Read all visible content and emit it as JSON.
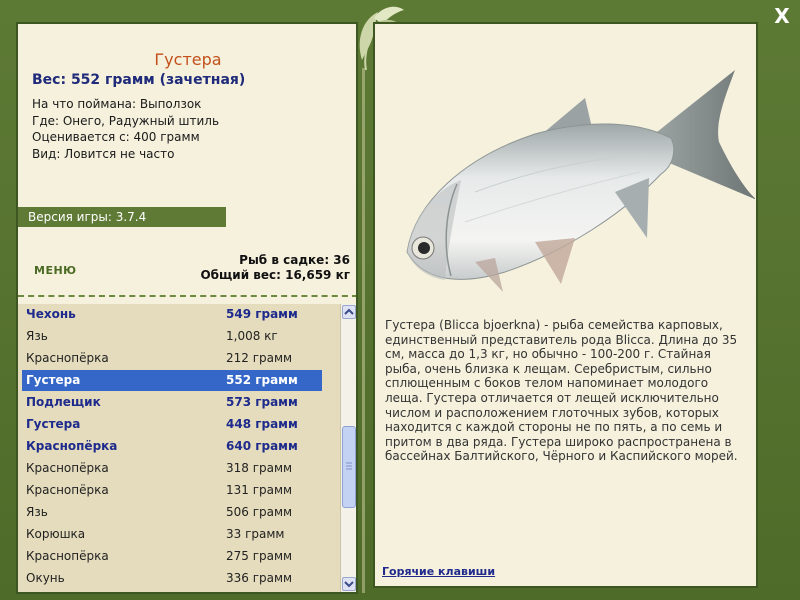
{
  "window": {
    "close_glyph": "X"
  },
  "fish": {
    "name": "Густера",
    "weight_line": "Вес: 552 грамм (зачетная)",
    "caught_on": "На что поймана: Выползок",
    "location": "Где: Онего, Радужный штиль",
    "valued_from": "Оценивается с: 400 грамм",
    "frequency": "Вид: Ловится не часто",
    "description": "Густера (Blicca bjoerkna) - рыба семейства карповых, единственный представитель рода Blicca. Длина до 35 см, масса до 1,3 кг, но обычно - 100-200 г. Стайная рыба, очень близка к лещам. Серебристым, сильно сплющенным с боков телом напоминает молодого леща. Густера отличается от лещей исключительно числом и расположением глоточных зубов, которых находится с каждой стороны не по пять, а по семь и притом в два ряда. Густера широко распространена в бассейнах Балтийского, Чёрного и Каспийского морей."
  },
  "version": "Версия игры: 3.7.4",
  "menu_label": "МЕНЮ",
  "stats": {
    "fish_in_net": "Рыб в садке: 36",
    "total_weight": "Общий вес: 16,659 кг"
  },
  "catch_list": [
    {
      "name": "Чехонь",
      "weight": "549 грамм",
      "style": "bold"
    },
    {
      "name": "Язь",
      "weight": "1,008 кг",
      "style": "normal"
    },
    {
      "name": "Краснопёрка",
      "weight": "212 грамм",
      "style": "normal"
    },
    {
      "name": "Густера",
      "weight": "552 грамм",
      "style": "selected"
    },
    {
      "name": "Подлещик",
      "weight": "573 грамм",
      "style": "bold"
    },
    {
      "name": "Густера",
      "weight": "448 грамм",
      "style": "bold"
    },
    {
      "name": "Краснопёрка",
      "weight": "640 грамм",
      "style": "bold"
    },
    {
      "name": "Краснопёрка",
      "weight": "318 грамм",
      "style": "normal"
    },
    {
      "name": "Краснопёрка",
      "weight": "131 грамм",
      "style": "normal"
    },
    {
      "name": "Язь",
      "weight": "506 грамм",
      "style": "normal"
    },
    {
      "name": "Корюшка",
      "weight": "33 грамм",
      "style": "normal"
    },
    {
      "name": "Краснопёрка",
      "weight": "275 грамм",
      "style": "normal"
    },
    {
      "name": "Окунь",
      "weight": "336 грамм",
      "style": "normal"
    }
  ],
  "hotkeys_link": "Горячие клавиши",
  "colors": {
    "frame": "#56722f",
    "panel": "#f5f1dd",
    "title": "#c3501b",
    "selected_row": "#3567c9",
    "bold_row": "#1e2a8c"
  },
  "icons": {
    "close": "close-icon",
    "ornament": "leaf-ornament-icon",
    "scroll_up": "arrow-up-icon",
    "scroll_down": "arrow-down-icon"
  }
}
